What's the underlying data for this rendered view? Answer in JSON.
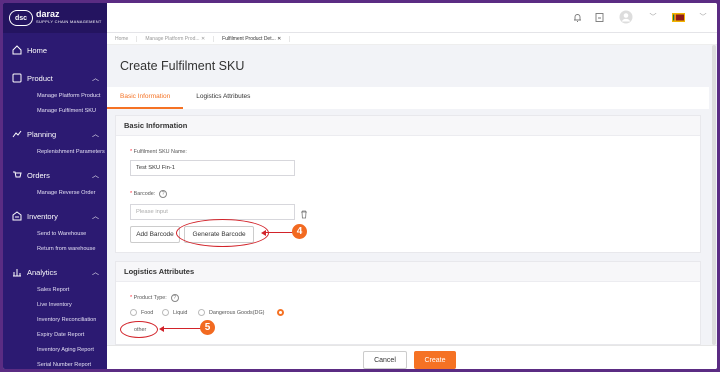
{
  "brand": {
    "logo_badge": "dsc",
    "name": "daraz",
    "subtitle": "SUPPLY CHAIN MANAGEMENT"
  },
  "sidebar": {
    "home": "Home",
    "sections": [
      {
        "label": "Product",
        "icon": "box-icon",
        "items": [
          "Manage Platform Product",
          "Manage Fulfilment SKU"
        ]
      },
      {
        "label": "Planning",
        "icon": "chart-line-icon",
        "items": [
          "Replenishment Parameters"
        ]
      },
      {
        "label": "Orders",
        "icon": "cart-icon",
        "items": [
          "Manage Reverse Order"
        ]
      },
      {
        "label": "Inventory",
        "icon": "warehouse-icon",
        "items": [
          "Send to Warehouse",
          "Return from warehouse"
        ]
      },
      {
        "label": "Analytics",
        "icon": "bar-chart-icon",
        "items": [
          "Sales Report",
          "Live Inventory",
          "Inventory Reconciliation",
          "Expiry Date Report",
          "Inventory Aging Report",
          "Serial Number Report"
        ]
      }
    ]
  },
  "tabs": [
    "Home",
    "Manage Platform Prod...",
    "Fulfilment Product Det..."
  ],
  "page_title": "Create Fulfilment SKU",
  "subtabs": [
    "Basic Information",
    "Logistics Attributes"
  ],
  "basic": {
    "heading": "Basic Information",
    "name_label": "Fulfilment SKU Name:",
    "name_value": "Test SKU Fin-1",
    "barcode_label": "Barcode:",
    "barcode_placeholder": "Please input",
    "add_barcode": "Add Barcode",
    "generate_barcode": "Generate Barcode"
  },
  "logistics": {
    "heading": "Logistics Attributes",
    "product_type_label": "Product Type:",
    "options": [
      "Food",
      "Liquid",
      "Dangerous Goods(DG)"
    ],
    "other_label": "other"
  },
  "annotations": {
    "step4": "4",
    "step5": "5"
  },
  "footer": {
    "cancel": "Cancel",
    "create": "Create"
  },
  "colors": {
    "accent": "#f57224",
    "sidebar": "#2c1a72",
    "annotation": "#d2232a"
  }
}
